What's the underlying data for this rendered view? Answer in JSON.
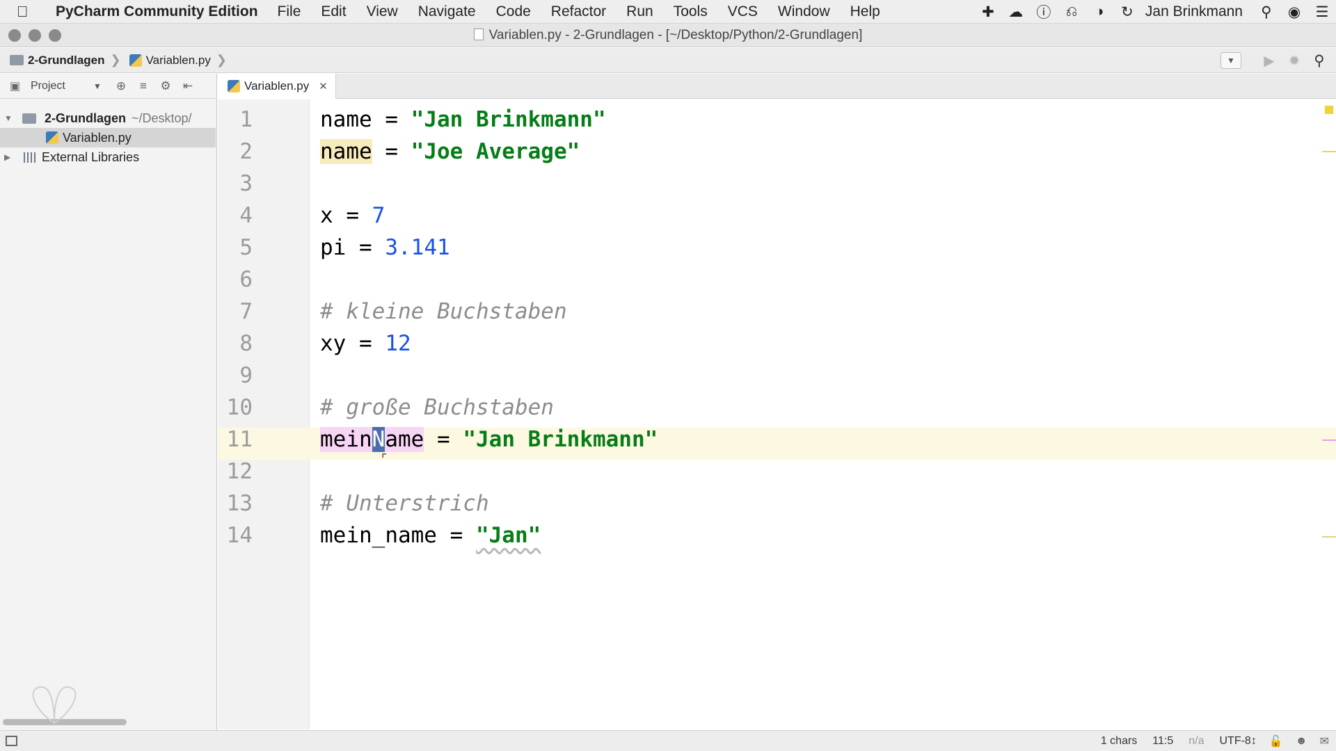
{
  "menubar": {
    "app_name": "PyCharm Community Edition",
    "items": [
      "File",
      "Edit",
      "View",
      "Navigate",
      "Code",
      "Refactor",
      "Run",
      "Tools",
      "VCS",
      "Window",
      "Help"
    ],
    "user": "Jan Brinkmann",
    "tray_icons": [
      "plus-icon",
      "creative-cloud-icon",
      "password-manager-icon",
      "backup-icon",
      "leaf-icon",
      "time-machine-icon"
    ]
  },
  "window": {
    "title": "Variablen.py - 2-Grundlagen - [~/Desktop/Python/2-Grundlagen]"
  },
  "navbar": {
    "project_crumb": "2-Grundlagen",
    "file_crumb": "Variablen.py"
  },
  "project_panel": {
    "view_label": "Project",
    "tree": {
      "root_name": "2-Grundlagen",
      "root_path": "~/Desktop/",
      "file": "Variablen.py",
      "external": "External Libraries"
    }
  },
  "editor": {
    "tab_label": "Variablen.py",
    "line_numbers": [
      "1",
      "2",
      "3",
      "4",
      "5",
      "6",
      "7",
      "8",
      "9",
      "10",
      "11",
      "12",
      "13",
      "14"
    ],
    "code": {
      "l1": {
        "name": "name",
        "op": " = ",
        "str": "\"Jan Brinkmann\""
      },
      "l2": {
        "name": "name",
        "op": " = ",
        "str": "\"Joe Average\""
      },
      "l4": {
        "name": "x",
        "op": " = ",
        "num": "7"
      },
      "l5": {
        "name": "pi",
        "op": " = ",
        "num": "3.141"
      },
      "l7": {
        "comment": "# kleine Buchstaben"
      },
      "l8": {
        "name": "xy",
        "op": " = ",
        "num": "12"
      },
      "l10": {
        "comment": "# große Buchstaben"
      },
      "l11": {
        "name_a": "mein",
        "name_sel": "N",
        "name_b": "ame",
        "op": " = ",
        "str": "\"Jan Brinkmann\""
      },
      "l13": {
        "comment": "# Unterstrich"
      },
      "l14": {
        "name": "mein_name",
        "op": " = ",
        "str": "\"Jan\""
      }
    }
  },
  "statusbar": {
    "chars": "1 chars",
    "position": "11:5",
    "na": "n/a",
    "encoding": "UTF-8↕"
  },
  "colors": {
    "string": "#067d17",
    "number": "#1750eb",
    "comment": "#8c8c8c",
    "caret_row": "#fdf8e2",
    "warning_highlight": "#f6ebbc",
    "identifier_highlight": "#f6d5f5",
    "selection": "#4b6eaf"
  }
}
